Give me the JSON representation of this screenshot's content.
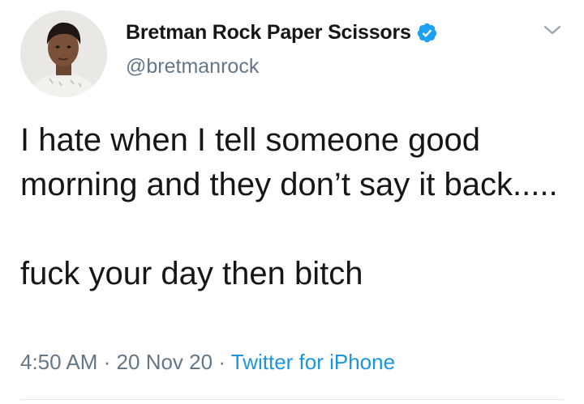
{
  "tweet": {
    "display_name": "Bretman Rock Paper Scissors",
    "handle": "@bretmanrock",
    "verified": true,
    "text_lines": [
      "I hate when I tell someone good morning and they don’t say it back.....",
      "fuck your day then bitch"
    ],
    "time": "4:50 AM",
    "separator": "·",
    "date": "20 Nov 20",
    "source": "Twitter for iPhone"
  },
  "colors": {
    "text": "#14171a",
    "secondary": "#657786",
    "link": "#1b95e0",
    "verified_badge": "#1da1f2"
  },
  "icons": {
    "avatar": "profile-photo",
    "verified": "verified-badge-icon",
    "more": "chevron-down-icon"
  }
}
